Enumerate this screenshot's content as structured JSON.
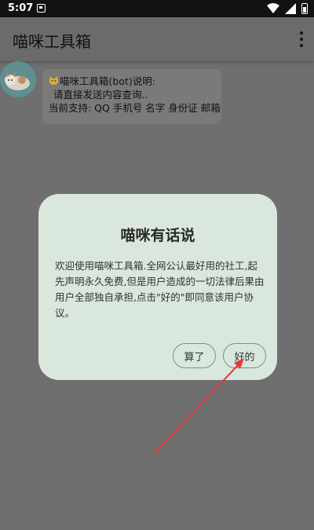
{
  "status_bar": {
    "time": "5:07"
  },
  "app_bar": {
    "title": "喵咪工具箱"
  },
  "chat": {
    "bubble_line1": "喵咪工具箱(bot)说明:",
    "bubble_line2": "请直接发送内容查询..",
    "bubble_line3": "当前支持: QQ 手机号 名字 身份证 邮箱"
  },
  "dialog": {
    "title": "喵咪有话说",
    "message": "欢迎使用喵咪工具箱.全网公认最好用的社工,起先声明永久免费,但是用户造成的一切法律后果由用户全部独自承担,点击\"好的\"即同意该用户协议。",
    "cancel_label": "算了",
    "ok_label": "好的"
  },
  "colors": {
    "arrow": "#e23b3b",
    "dialog_bg": "#d9e7dc"
  },
  "icons": [
    "wifi-icon",
    "signal-icon",
    "battery-icon",
    "notification-icon",
    "overflow-menu-icon",
    "cat-emoji-icon"
  ]
}
